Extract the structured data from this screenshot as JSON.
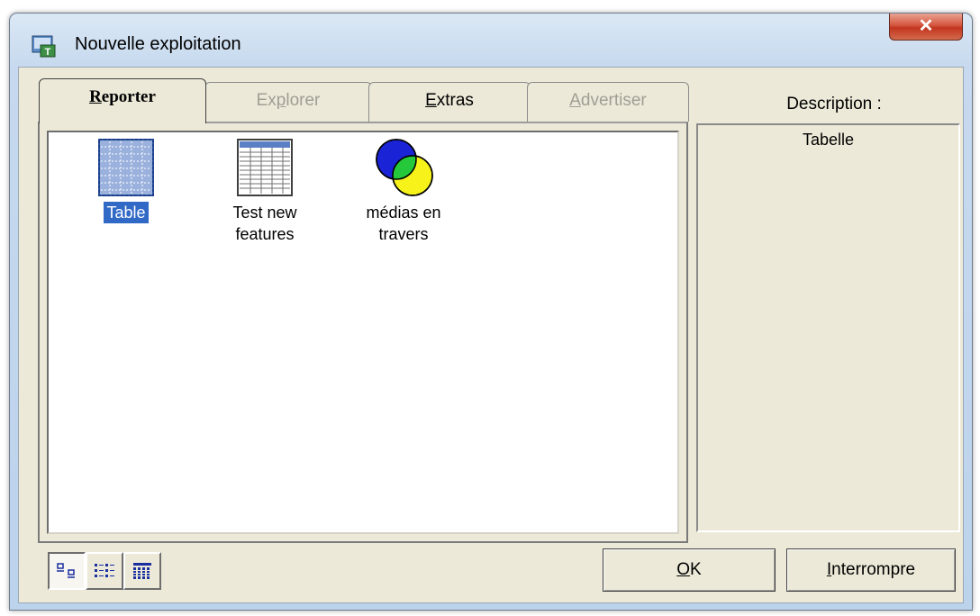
{
  "window": {
    "title": "Nouvelle exploitation",
    "close_label": "✕"
  },
  "tabs": [
    {
      "first": "R",
      "rest": "eporter"
    },
    {
      "first": "Ex",
      "underline": "p",
      "rest": "lorer"
    },
    {
      "first": "",
      "underline": "E",
      "rest": "xtras"
    },
    {
      "first": "",
      "underline": "A",
      "rest": "dvertiser"
    }
  ],
  "items": [
    {
      "label": "Table"
    },
    {
      "label1": "Test new",
      "label2": "features"
    },
    {
      "label1": "médias en",
      "label2": "travers"
    }
  ],
  "description": {
    "heading": "Description :",
    "text": "Tabelle"
  },
  "buttons": {
    "ok": {
      "underline": "O",
      "rest": "K"
    },
    "cancel": {
      "underline": "I",
      "rest": "nterrompre"
    }
  }
}
